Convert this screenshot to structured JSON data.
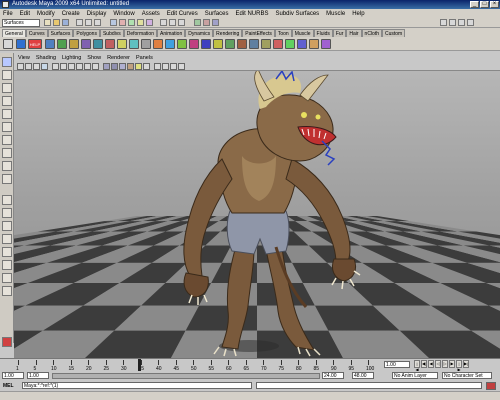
{
  "window": {
    "title": "Autodesk Maya 2009 x64 Unlimited: untitled"
  },
  "menu": [
    "File",
    "Edit",
    "Modify",
    "Create",
    "Display",
    "Window",
    "Assets",
    "Edit Curves",
    "Surfaces",
    "Edit NURBS",
    "Subdiv Surfaces",
    "Muscle",
    "Help"
  ],
  "status": {
    "mode": "Surfaces"
  },
  "shelf_tabs": [
    "General",
    "Curves",
    "Surfaces",
    "Polygons",
    "Subdivs",
    "Deformation",
    "Animation",
    "Dynamics",
    "Rendering",
    "PaintEffects",
    "Toon",
    "Muscle",
    "Fluids",
    "Fur",
    "Hair",
    "nCloth",
    "Custom"
  ],
  "shelf": {
    "help_label": "HELP"
  },
  "panel_menu": [
    "View",
    "Shading",
    "Lighting",
    "Show",
    "Renderer",
    "Panels"
  ],
  "timeline": {
    "ticks": [
      "1",
      "5",
      "10",
      "15",
      "20",
      "25",
      "30",
      "35",
      "40",
      "45",
      "50",
      "55",
      "60",
      "65",
      "70",
      "75",
      "80",
      "85",
      "90",
      "95",
      "100"
    ],
    "current_frame": "1.00"
  },
  "range": {
    "start": "1.00",
    "inner_start": "1.00",
    "end": "24.00",
    "max_end": "48.00",
    "anim_layer": "No Anim Layer",
    "char_set": "No Character Set"
  },
  "command": {
    "label": "MEL",
    "text": "Maya:*:*ref:*(1)"
  },
  "colors": {
    "title_bg": "#0a246a",
    "accent": "#3a6ea5",
    "grid_dark": "#3c3c3c",
    "grid_light": "#8a8a8a"
  }
}
